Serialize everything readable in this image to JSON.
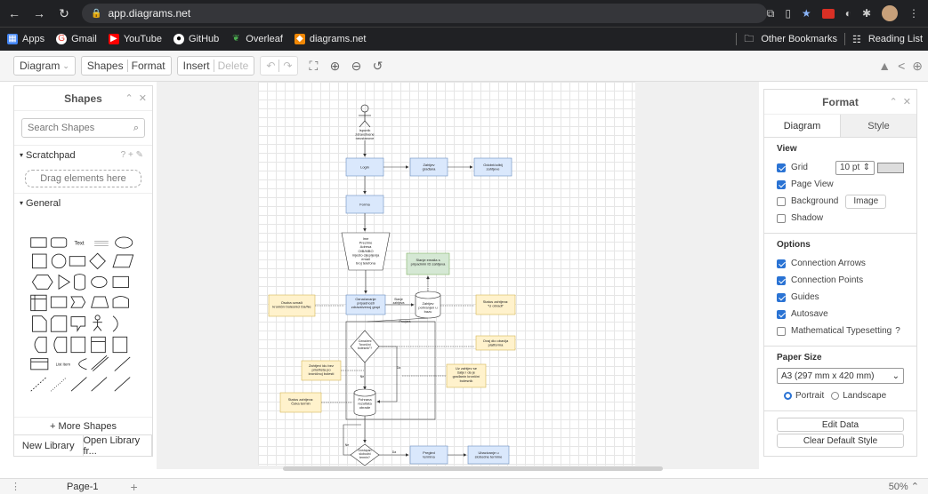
{
  "browser": {
    "url": "app.diagrams.net",
    "bookmarks": [
      "Apps",
      "Gmail",
      "YouTube",
      "GitHub",
      "Overleaf",
      "diagrams.net"
    ],
    "other_bookmarks": "Other Bookmarks",
    "reading_list": "Reading List"
  },
  "toolbar": {
    "diagram": "Diagram",
    "shapes": "Shapes",
    "format": "Format",
    "insert": "Insert",
    "delete": "Delete"
  },
  "shapes_panel": {
    "title": "Shapes",
    "search_placeholder": "Search Shapes",
    "scratchpad": "Scratchpad",
    "drag_hint": "Drag elements here",
    "general": "General",
    "text_label": "Text",
    "list_item_label": "List Item",
    "more_shapes": "+ More Shapes",
    "new_library": "New Library",
    "open_library": "Open Library fr..."
  },
  "format_panel": {
    "title": "Format",
    "tab_diagram": "Diagram",
    "tab_style": "Style",
    "view_title": "View",
    "grid": "Grid",
    "grid_size": "10 pt",
    "page_view": "Page View",
    "background": "Background",
    "image_button": "Image",
    "shadow": "Shadow",
    "options_title": "Options",
    "connection_arrows": "Connection Arrows",
    "connection_points": "Connection Points",
    "guides": "Guides",
    "autosave": "Autosave",
    "math": "Mathematical Typesetting",
    "paper_size_title": "Paper Size",
    "paper_size": "A3 (297 mm x 420 mm)",
    "portrait": "Portrait",
    "landscape": "Landscape",
    "edit_data": "Edit Data",
    "clear_style": "Clear Default Style"
  },
  "diagram": {
    "actor": "Ispunik\nzdravstvene\nneustanove",
    "login": "Login",
    "zahtjev_gradana": "Zahtjev\ngrađana",
    "odobri": "Odobri/odbij\nzahtjeve",
    "forma": "Forma",
    "podaci": "Ime\nPrezime\nAdresa\nOIB/MBO\nmjesto cijepljenja\nemail\nbroj telefona",
    "email": "Slanje emaila s\npripadnim ID zahtjeva",
    "osoba": "Osoba označi\nkroniční bolesnici Da/Ne",
    "oznacavanje": "Označavanje\npripadnosti\nzdravstvenoj grupi",
    "slanje": "Slanje\nzahtjeva",
    "zahtjev_pohranjen": "Zahtjev\npohranjen u\nbazu",
    "status_obrada": "Status zahtjeva:\n\"U obradi\"",
    "provjera": "Provjera",
    "oznacen": "Označeni\n\"kroniční\nbolesnik\"?",
    "ovaj_dio": "Ovaj dio obavlja\nplatforma",
    "zahtjevi_bez": "Zahtjevi idu bez\nprioriteta po\nkroničnoj bolesti",
    "uz_zahtjev": "Uz zahtjev se\nšalje i da je\ngrađanin kroniční\nbolesnik",
    "ne": "Ne",
    "da": "Da",
    "status_ceka": "Status zahtjeva:\nČeka termin",
    "pohrana": "Pohrana\nrezultata\nobrade",
    "dostupan": "Dostupan\nslobodni\ntermin?",
    "pregled": "Pregled\ntermina",
    "ubacivanje": "Ubacivanje u\nslobodne termine"
  },
  "bottom": {
    "page_tab": "Page-1",
    "zoom": "50%"
  }
}
